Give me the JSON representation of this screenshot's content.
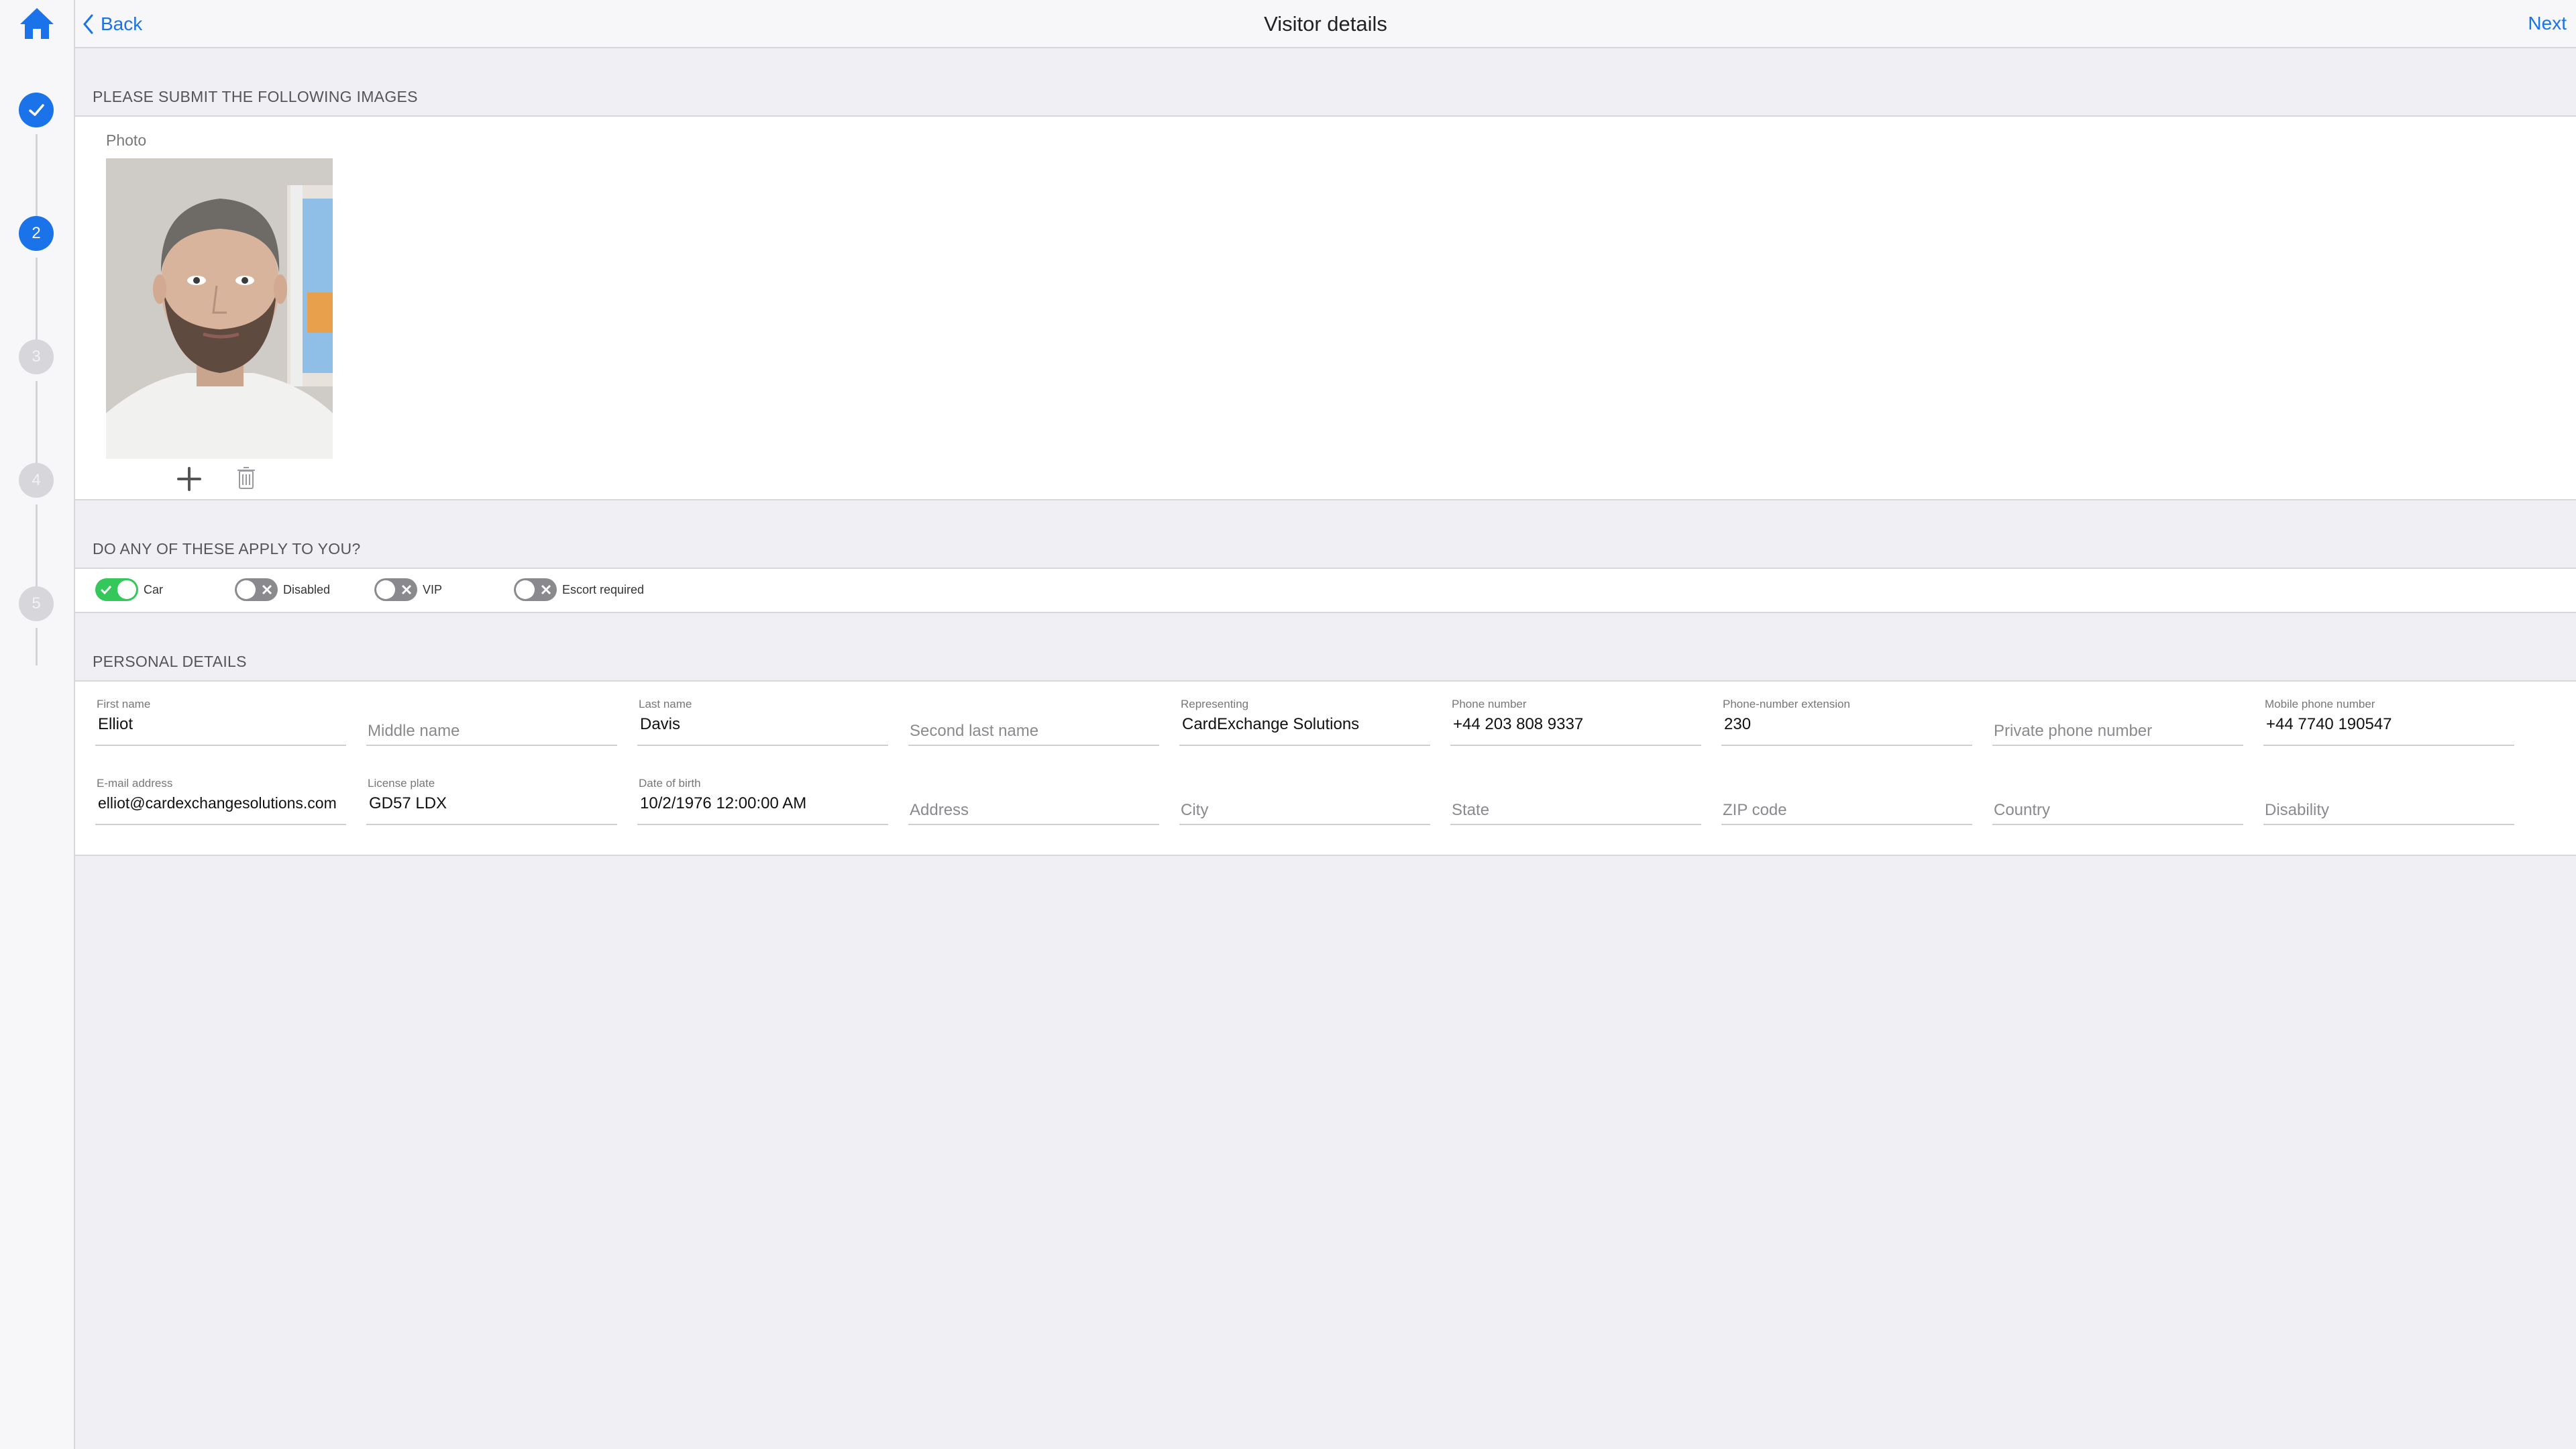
{
  "header": {
    "back_label": "Back",
    "title": "Visitor details",
    "next_label": "Next"
  },
  "sidebar": {
    "steps": [
      {
        "label": "",
        "state": "done"
      },
      {
        "label": "2",
        "state": "active"
      },
      {
        "label": "3",
        "state": "inactive"
      },
      {
        "label": "4",
        "state": "inactive"
      },
      {
        "label": "5",
        "state": "inactive"
      }
    ]
  },
  "images_section": {
    "title": "PLEASE SUBMIT THE FOLLOWING IMAGES",
    "photo_label": "Photo"
  },
  "apply_section": {
    "title": "DO ANY OF THESE APPLY TO YOU?",
    "toggles": [
      {
        "label": "Car",
        "on": true
      },
      {
        "label": "Disabled",
        "on": false
      },
      {
        "label": "VIP",
        "on": false
      },
      {
        "label": "Escort required",
        "on": false
      }
    ]
  },
  "personal_section": {
    "title": "PERSONAL DETAILS",
    "fields": {
      "first_name": {
        "label": "First name",
        "value": "Elliot"
      },
      "middle_name": {
        "placeholder": "Middle name"
      },
      "last_name": {
        "label": "Last name",
        "value": "Davis"
      },
      "second_last_name": {
        "placeholder": "Second last name"
      },
      "representing": {
        "label": "Representing",
        "value": "CardExchange Solutions"
      },
      "phone_number": {
        "label": "Phone number",
        "value": "+44 203 808 9337"
      },
      "phone_ext": {
        "label": "Phone-number extension",
        "value": "230"
      },
      "private_phone": {
        "placeholder": "Private phone number"
      },
      "mobile_phone": {
        "label": "Mobile phone number",
        "value": "+44 7740 190547"
      },
      "email": {
        "label": "E-mail address",
        "value": "elliot@cardexchangesolutions.com"
      },
      "license_plate": {
        "label": "License plate",
        "value": "GD57 LDX"
      },
      "dob": {
        "label": "Date of birth",
        "value": "10/2/1976 12:00:00 AM"
      },
      "address": {
        "placeholder": "Address"
      },
      "city": {
        "placeholder": "City"
      },
      "state": {
        "placeholder": "State"
      },
      "zip": {
        "placeholder": "ZIP code"
      },
      "country": {
        "placeholder": "Country"
      },
      "disability": {
        "placeholder": "Disability"
      }
    }
  },
  "colors": {
    "accent": "#1a73e8",
    "toggle_on": "#34c759",
    "toggle_off": "#8a8a8e",
    "background": "#efeff4"
  }
}
